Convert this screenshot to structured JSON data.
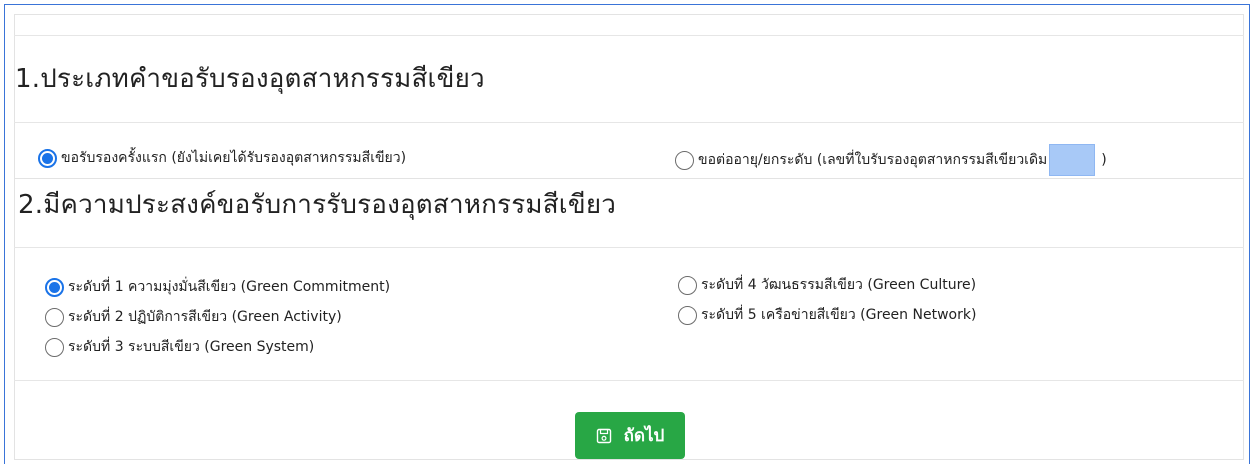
{
  "section1": {
    "title": "1.ประเภทคำขอรับรองอุตสาหกรรมสีเขียว",
    "options": [
      {
        "label": "ขอรับรองครั้งแรก (ยังไม่เคยได้รับรองอุตสาหกรรมสีเขียว)",
        "checked": true
      },
      {
        "label": "ขอต่ออายุ/ยกระดับ (เลขที่ใบรับรองอุตสาหกรรมสีเขียวเดิม",
        "checked": false,
        "close_paren": ")",
        "input_value": ""
      }
    ]
  },
  "section2": {
    "title": "2.มีความประสงค์ขอรับการรับรองอุตสาหกรรมสีเขียว",
    "levels": [
      {
        "label": "ระดับที่ 1 ความมุ่งมั่นสีเขียว (Green Commitment)",
        "checked": true
      },
      {
        "label": "ระดับที่ 2 ปฏิบัติการสีเขียว (Green Activity)",
        "checked": false
      },
      {
        "label": "ระดับที่ 3 ระบบสีเขียว (Green System)",
        "checked": false
      },
      {
        "label": "ระดับที่ 4 วัฒนธรรมสีเขียว (Green Culture)",
        "checked": false
      },
      {
        "label": "ระดับที่ 5 เครือข่ายสีเขียว (Green Network)",
        "checked": false
      }
    ]
  },
  "actions": {
    "next_label": "ถัดไป"
  },
  "colors": {
    "accent": "#1a73e8",
    "button": "#28a745",
    "input_fill": "#a8c9f7"
  }
}
